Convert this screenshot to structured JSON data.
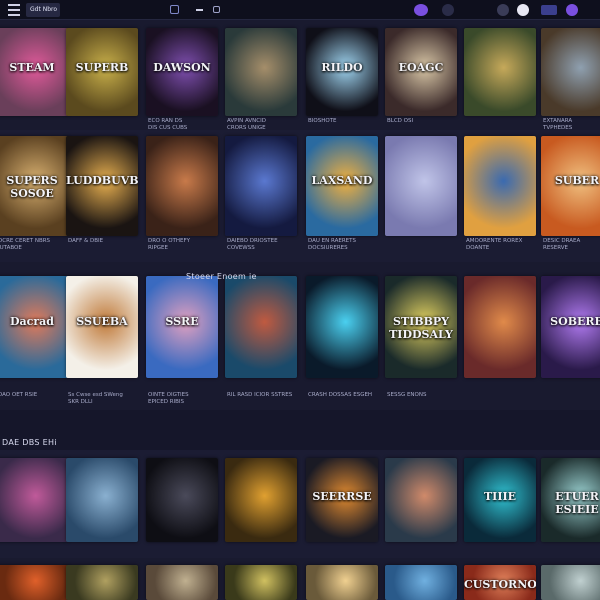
{
  "topbar": {
    "search_value": "Gdt Nbro",
    "icons": [
      "menu-icon",
      "library-icon",
      "minimize-icon",
      "chat-icon",
      "storefront-icon",
      "profile-icon",
      "grid-icon",
      "settings-icon"
    ]
  },
  "colors": {
    "background": "#15162a",
    "topbar": "#0e0f1d",
    "accent": "#6a5acd",
    "caption": "#a8abc9"
  },
  "sections": [
    {
      "title": "Stoeer Enoem ie",
      "position_note": "carousel-2"
    },
    {
      "title": "DAE DBS EHi"
    }
  ],
  "rows": [
    {
      "tiles": [
        {
          "title": "STEAM",
          "colors": [
            "#6a3f5a",
            "#e05a9a"
          ],
          "caption": ""
        },
        {
          "title": "SUPERB",
          "colors": [
            "#5b4a1e",
            "#c9b04a"
          ],
          "caption": ""
        },
        {
          "title": "DAWSON",
          "colors": [
            "#1a1022",
            "#7f4fb0"
          ],
          "caption": "ECO RAN DS\nDIS CUS CUBS"
        },
        {
          "title": "",
          "colors": [
            "#2a3a3a",
            "#a58e6a"
          ],
          "caption": "AVPIN AVNCID\nCRORS UNIGE"
        },
        {
          "title": "RILDO",
          "colors": [
            "#0f0f18",
            "#9fd4f0"
          ],
          "caption": "BIOSHOTE"
        },
        {
          "title": "EOAGC",
          "colors": [
            "#3b2a2a",
            "#d8c6a6"
          ],
          "caption": "BLCD OSI"
        },
        {
          "title": "",
          "colors": [
            "#3a4a2a",
            "#c6a95a"
          ],
          "caption": ""
        },
        {
          "title": "",
          "colors": [
            "#4a3a2a",
            "#8fa0b0"
          ],
          "caption": "EXTANARA\nTVPHEDES"
        }
      ]
    },
    {
      "tiles": [
        {
          "title": "SUPERS SOSOE",
          "colors": [
            "#5a4020",
            "#d8b070"
          ],
          "caption": "DCRE CERET NBRS\nIUTABOE"
        },
        {
          "title": "LUDDBUVBE",
          "colors": [
            "#1a1412",
            "#e8b050"
          ],
          "caption": "DAFF & DBIE"
        },
        {
          "title": "",
          "colors": [
            "#3a2218",
            "#c87a4a"
          ],
          "caption": "DRO O OTHEFY\nRIPGEE"
        },
        {
          "title": "",
          "colors": [
            "#141a40",
            "#5a78d0"
          ],
          "caption": "DAIEBO DRIOSTEE\nCOVEWSS"
        },
        {
          "title": "LAXSAND",
          "colors": [
            "#2a6aa0",
            "#f0b040"
          ],
          "caption": "DAU EN RAERETS\nDOCSIURERES"
        },
        {
          "title": "",
          "colors": [
            "#7a7ab0",
            "#c0c4e8"
          ],
          "caption": ""
        },
        {
          "title": "",
          "colors": [
            "#e0a040",
            "#3a6ab0"
          ],
          "caption": "AMOORENTE ROREX\nDOANTE"
        },
        {
          "title": "SUBER",
          "colors": [
            "#c85a20",
            "#f0c080"
          ],
          "caption": "DESIC DRAEA\nRESERVE"
        }
      ]
    },
    {
      "tiles": [
        {
          "title": "Dacrad",
          "colors": [
            "#2a6a9a",
            "#e07a5a"
          ],
          "caption": "DAO OET RSIE"
        },
        {
          "title": "SSUEBA",
          "colors": [
            "#f4f0e8",
            "#c07a3a"
          ],
          "caption": "Ss Cwse esd SWeng\nSKR DLLI"
        },
        {
          "title": "SSRE",
          "colors": [
            "#3a6ac0",
            "#e0a0c0"
          ],
          "caption": "OINTE OIGTIES\nEPICED RIBIS"
        },
        {
          "title": "",
          "colors": [
            "#1a4a6a",
            "#c05a40"
          ],
          "caption": "RIL RASD ICIOR SSTRES"
        },
        {
          "title": "",
          "colors": [
            "#0a1a2a",
            "#4ad0f0"
          ],
          "caption": "CRASH DOSSAS ESGEH"
        },
        {
          "title": "STIBBPY TIDDSALY",
          "colors": [
            "#1a2a2a",
            "#e0d060"
          ],
          "caption": "SESSG ENONS"
        },
        {
          "title": "",
          "colors": [
            "#6a2a2a",
            "#e08a4a"
          ],
          "caption": ""
        },
        {
          "title": "SOBERB",
          "colors": [
            "#2a1a4a",
            "#b07af0"
          ],
          "caption": ""
        }
      ]
    },
    {
      "tiles": [
        {
          "title": "",
          "colors": [
            "#3a2a4a",
            "#c05a9a"
          ],
          "caption": ""
        },
        {
          "title": "",
          "colors": [
            "#2a4a6a",
            "#8ab0d0"
          ],
          "caption": ""
        },
        {
          "title": "",
          "colors": [
            "#0e0e14",
            "#4a4a5a"
          ],
          "caption": ""
        },
        {
          "title": "",
          "colors": [
            "#3a2a10",
            "#e0a030"
          ],
          "caption": ""
        },
        {
          "title": "SEERRSE",
          "colors": [
            "#1a1a24",
            "#e08a30"
          ],
          "caption": ""
        },
        {
          "title": "",
          "colors": [
            "#2a3a4a",
            "#d08a6a"
          ],
          "caption": ""
        },
        {
          "title": "TIIIE",
          "colors": [
            "#0a2a3a",
            "#30c0d0"
          ],
          "caption": ""
        },
        {
          "title": "ETUER ESIEIE",
          "colors": [
            "#1a2a2a",
            "#9ad0d0"
          ],
          "caption": ""
        }
      ]
    },
    {
      "tiles": [
        {
          "title": "",
          "colors": [
            "#6a2a10",
            "#e0602a"
          ],
          "caption": ""
        },
        {
          "title": "",
          "colors": [
            "#3a3a20",
            "#b0a060"
          ],
          "caption": ""
        },
        {
          "title": "",
          "colors": [
            "#5a4a3a",
            "#c0b090"
          ],
          "caption": ""
        },
        {
          "title": "",
          "colors": [
            "#3a3a1a",
            "#d0c060"
          ],
          "caption": ""
        },
        {
          "title": "",
          "colors": [
            "#6a5a3a",
            "#f0d090"
          ],
          "caption": ""
        },
        {
          "title": "",
          "colors": [
            "#2a5a8a",
            "#70b0e0"
          ],
          "caption": ""
        },
        {
          "title": "CUSTORNO",
          "colors": [
            "#8a2a1a",
            "#e0805a"
          ],
          "caption": ""
        },
        {
          "title": "",
          "colors": [
            "#5a6a6a",
            "#c0d0d0"
          ],
          "caption": ""
        }
      ]
    }
  ]
}
